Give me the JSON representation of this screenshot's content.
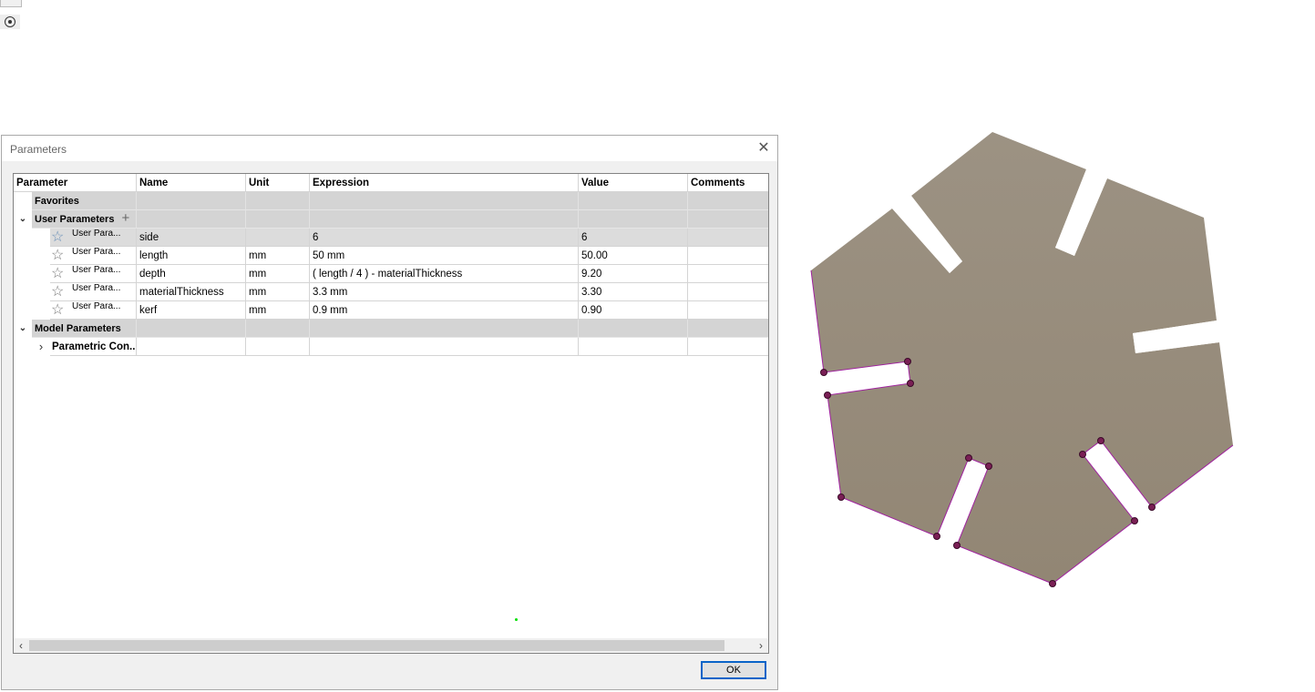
{
  "dialog": {
    "title": "Parameters",
    "close_glyph": "✕",
    "ok_label": "OK"
  },
  "table": {
    "headers": [
      "Parameter",
      "Name",
      "Unit",
      "Expression",
      "Value",
      "Comments"
    ],
    "groups": {
      "favorites": "Favorites",
      "user_parameters": "User Parameters",
      "model_parameters": "Model Parameters"
    },
    "add_glyph": "+",
    "rows": [
      {
        "type": "User Para...",
        "name": "side",
        "unit": "",
        "expression": "6",
        "value": "6",
        "comment": ""
      },
      {
        "type": "User Para...",
        "name": "length",
        "unit": "mm",
        "expression": "50 mm",
        "value": "50.00",
        "comment": ""
      },
      {
        "type": "User Para...",
        "name": "depth",
        "unit": "mm",
        "expression": "( length / 4 ) - materialThickness",
        "value": "9.20",
        "comment": ""
      },
      {
        "type": "User Para...",
        "name": "materialThickness",
        "unit": "mm",
        "expression": "3.3 mm",
        "value": "3.30",
        "comment": ""
      },
      {
        "type": "User Para...",
        "name": "kerf",
        "unit": "mm",
        "expression": "0.9 mm",
        "value": "0.90",
        "comment": ""
      }
    ],
    "sub_group": "Parametric Con...",
    "selected_row": 0
  },
  "icons": {
    "star": "☆",
    "expanded": "⌄",
    "collapsed": "›",
    "scroll_left": "‹",
    "scroll_right": "›"
  },
  "colors": {
    "shape_fill": "#968b7b",
    "shape_edge": "#a020a0",
    "point": "#7a1f55",
    "ok_border": "#0a64c8"
  }
}
